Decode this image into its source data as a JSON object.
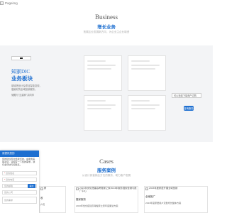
{
  "header": {
    "broken_image_alt": "Pageimg"
  },
  "business": {
    "title_en": "Business",
    "title_cn": "增长业务",
    "subtitle": "拓展企业发展新方向，为企业主企业增资"
  },
  "biz_block": {
    "title_en": "知家DIC",
    "title_cn": "业务板块",
    "desc_line1": "慈城把设计及项目智能变现，",
    "desc_line2": "做最好的全域营销服务。",
    "desc_line3": "储藏与\"互建商\"共同享"
  },
  "floating": {
    "tip_text": "可以在线下单商户订购",
    "button_label": "咨询服务"
  },
  "form": {
    "header": "请提供您的",
    "intro": "您的建议您交给我们的，由服务来联系您，请填写一下您的需求，我们会尽快与您联系。",
    "fields": [
      {
        "placeholder": "您的姓名"
      },
      {
        "placeholder": "您的电话"
      },
      {
        "placeholder": "您的邮箱"
      },
      {
        "placeholder": "您的公司"
      },
      {
        "placeholder": "您的需求"
      }
    ],
    "submit_label": "提交"
  },
  "cases": {
    "title_en": "Cases",
    "title_cn": "服务案例",
    "subtitle": "从设计到营销全方位的服务，助力客户发展",
    "items": [
      {
        "img_alt": "移",
        "name": "收",
        "desc": "户页"
      },
      {
        "img_alt": "2023年优化搭建高考搬家之家2023年服务搜索营销与推广中心",
        "name": "搬家服务",
        "desc": "2023年优化搭建高考搬家之家年度策划方案"
      },
      {
        "img_alt": "2023年度家居开展全域营销",
        "name": "全案推广",
        "desc": "2023年度家居用户流量增长整体方案"
      }
    ]
  }
}
